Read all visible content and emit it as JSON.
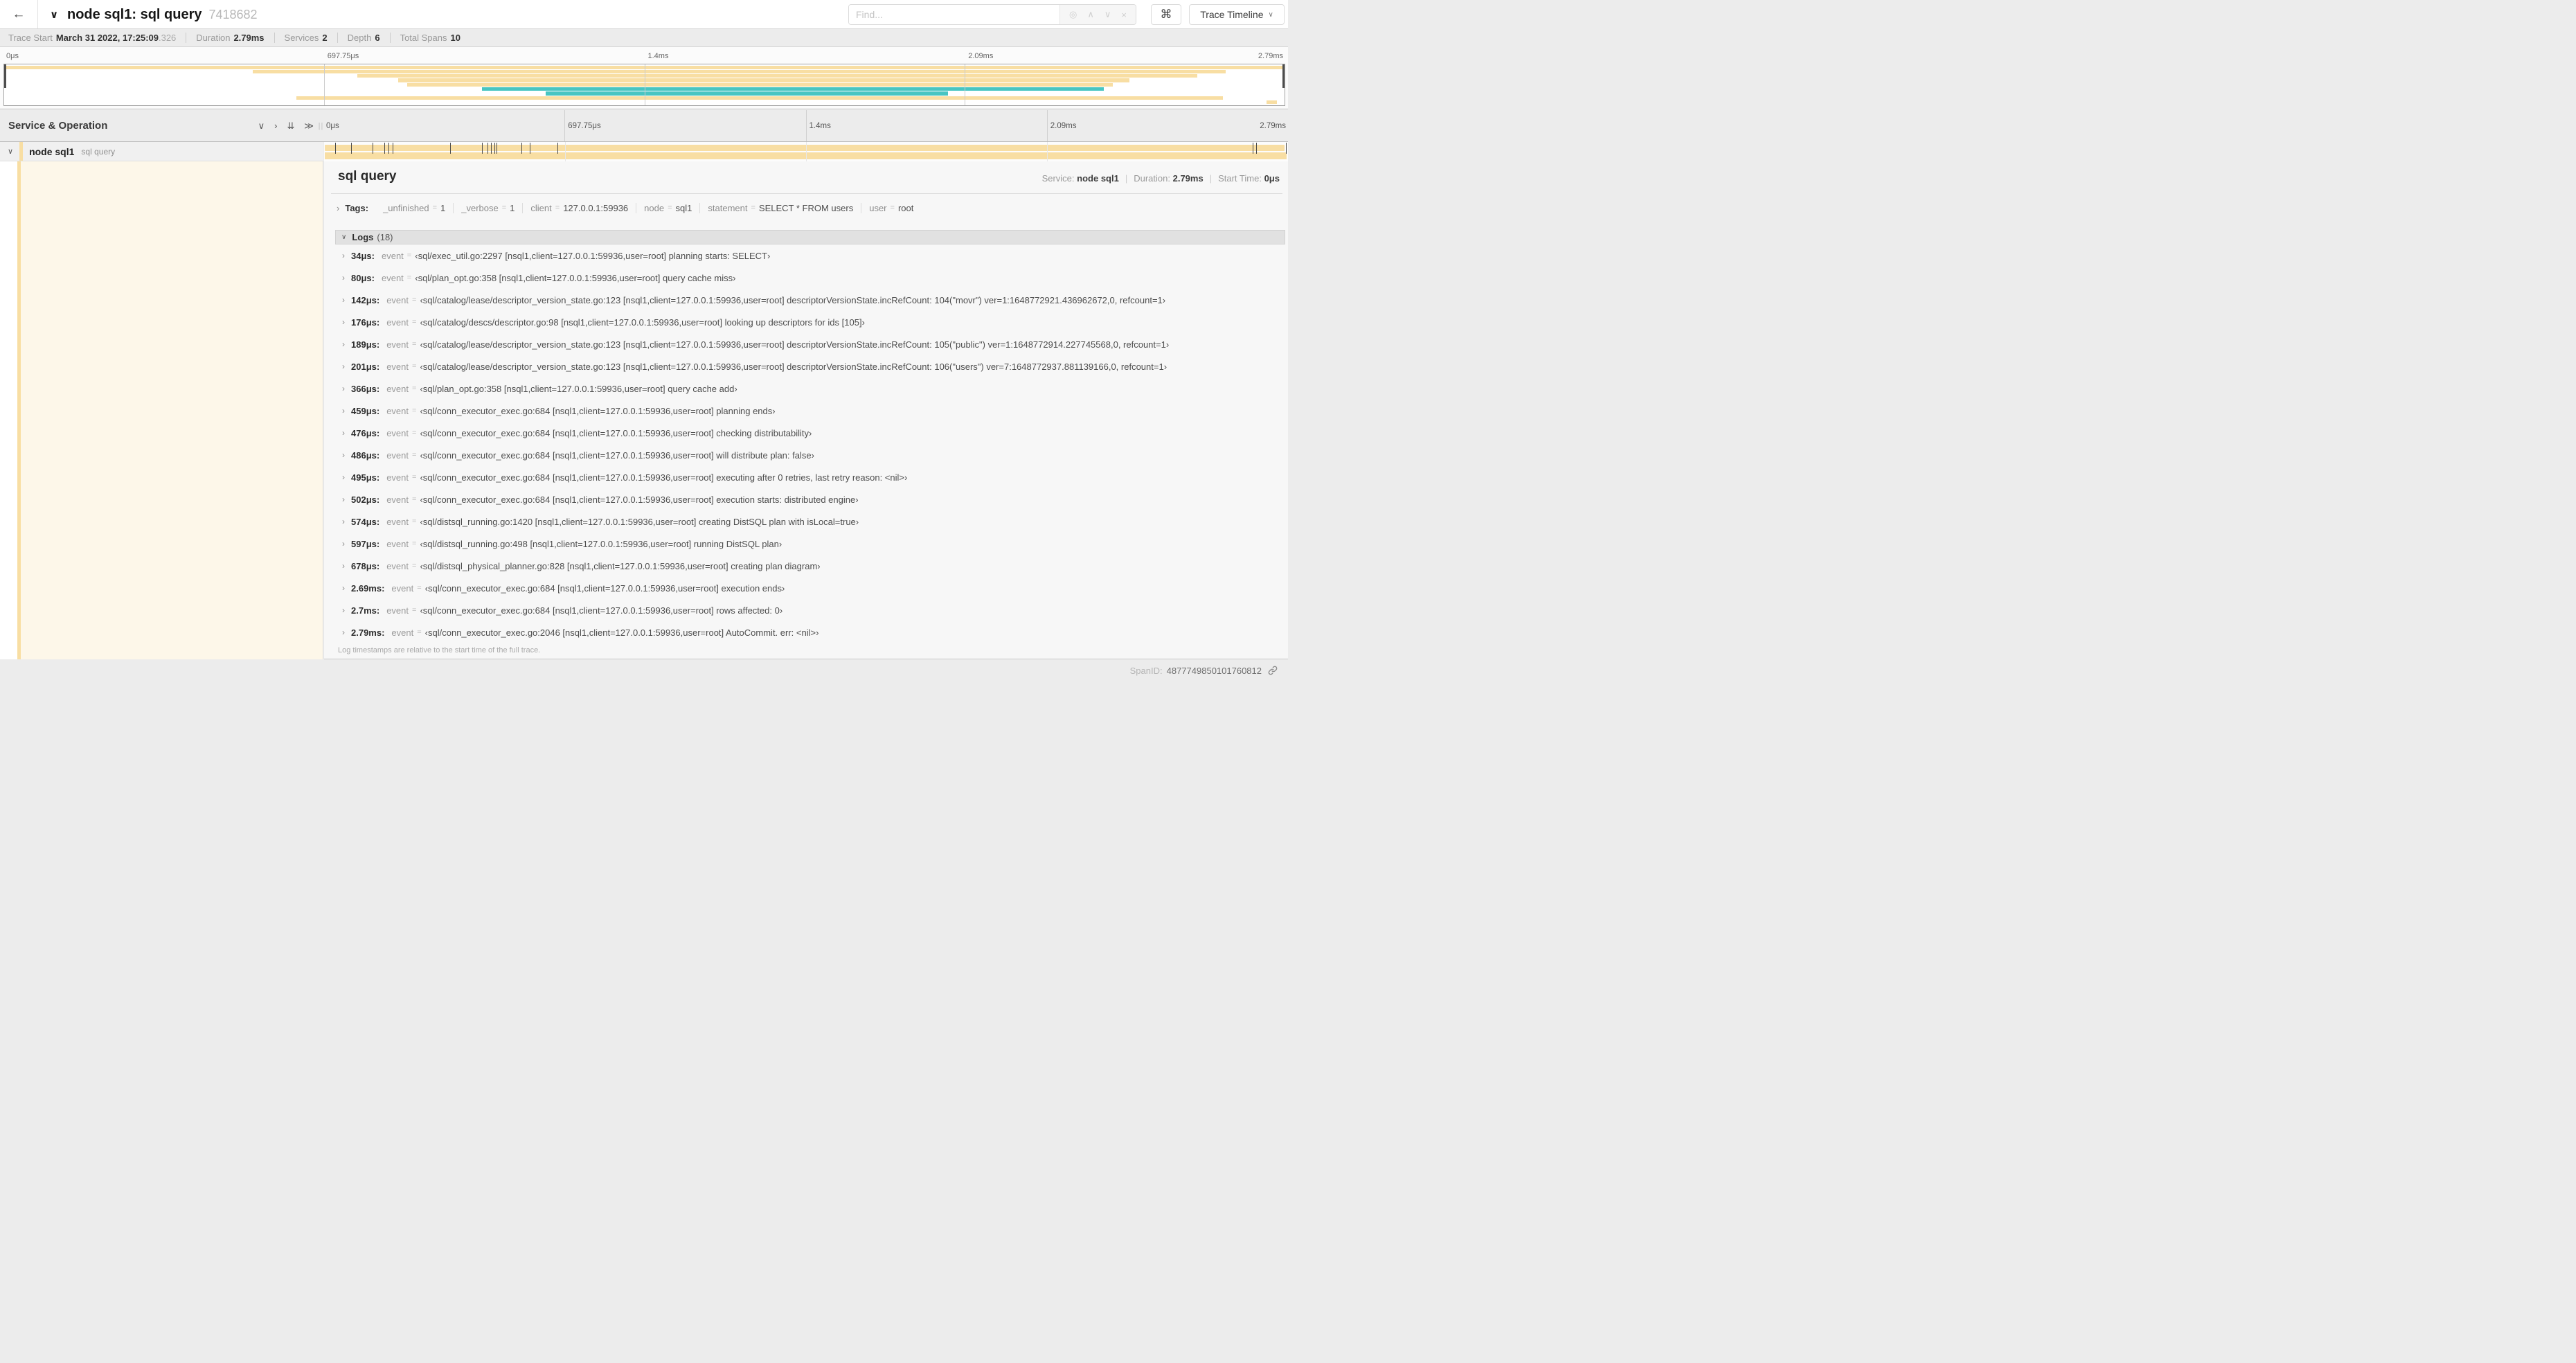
{
  "icons": {
    "back": "←",
    "collapse_trace": "∨",
    "find_locate": "◎",
    "find_prev": "∧",
    "find_next": "∨",
    "find_clear": "×",
    "shortcut": "⌘",
    "dropdown_caret": "∨",
    "collapse_one": "∨",
    "expand_one": "›",
    "collapse_all": "⇊",
    "expand_all": "≫",
    "resize_handle": "||",
    "row_chevron": "∨",
    "item_chevron": "›"
  },
  "header": {
    "title": "node sql1: sql query",
    "trace_id": "7418682",
    "find_placeholder": "Find...",
    "view_label": "Trace Timeline"
  },
  "meta": {
    "items": [
      {
        "label": "Trace Start",
        "value": "March 31 2022, 17:25:09",
        "suffix": ".326"
      },
      {
        "label": "Duration",
        "value": "2.79ms",
        "suffix": ""
      },
      {
        "label": "Services",
        "value": "2",
        "suffix": ""
      },
      {
        "label": "Depth",
        "value": "6",
        "suffix": ""
      },
      {
        "label": "Total Spans",
        "value": "10",
        "suffix": ""
      }
    ]
  },
  "colors": {
    "tan": "#f8dea3",
    "teal": "#48c5c2"
  },
  "timeline": {
    "left_header": "Service & Operation",
    "ticks": [
      "0μs",
      "697.75μs",
      "1.4ms",
      "2.09ms",
      "2.79ms"
    ],
    "total_us": 2790,
    "span": {
      "service": "node sql1",
      "operation": "sql query"
    },
    "markers_us": [
      34,
      80,
      142,
      176,
      189,
      201,
      366,
      459,
      476,
      486,
      495,
      502,
      574,
      597,
      678,
      2690,
      2700,
      2786
    ],
    "minimap_rows": [
      {
        "s": 0,
        "e": 100,
        "c": "tan"
      },
      {
        "s": 19.4,
        "e": 95.4,
        "c": "tan"
      },
      {
        "s": 27.6,
        "e": 93.2,
        "c": "tan"
      },
      {
        "s": 30.8,
        "e": 87.9,
        "c": "tan"
      },
      {
        "s": 31.5,
        "e": 86.6,
        "c": "tan"
      },
      {
        "s": 37.3,
        "e": 85.9,
        "c": "teal"
      },
      {
        "s": 42.3,
        "e": 73.7,
        "c": "teal"
      },
      {
        "s": 22.8,
        "e": 95.2,
        "c": "tan"
      },
      {
        "s": 98.6,
        "e": 99.4,
        "c": "tan"
      }
    ]
  },
  "detail": {
    "title": "sql query",
    "service_label": "Service:",
    "service": "node sql1",
    "duration_label": "Duration:",
    "duration": "2.79ms",
    "start_label": "Start Time:",
    "start": "0μs",
    "tags_label": "Tags:",
    "tags": [
      {
        "key": "_unfinished",
        "value": "1"
      },
      {
        "key": "_verbose",
        "value": "1"
      },
      {
        "key": "client",
        "value": "127.0.0.1:59936"
      },
      {
        "key": "node",
        "value": "sql1"
      },
      {
        "key": "statement",
        "value": "SELECT * FROM users"
      },
      {
        "key": "user",
        "value": "root"
      }
    ],
    "logs_label": "Logs",
    "logs_count": "(18)",
    "log_key": "event",
    "logs": [
      {
        "t": "34μs:",
        "msg": "‹sql/exec_util.go:2297 [nsql1,client=127.0.0.1:59936,user=root] planning starts: SELECT›"
      },
      {
        "t": "80μs:",
        "msg": "‹sql/plan_opt.go:358 [nsql1,client=127.0.0.1:59936,user=root] query cache miss›"
      },
      {
        "t": "142μs:",
        "msg": "‹sql/catalog/lease/descriptor_version_state.go:123 [nsql1,client=127.0.0.1:59936,user=root] descriptorVersionState.incRefCount: 104(\"movr\") ver=1:1648772921.436962672,0, refcount=1›"
      },
      {
        "t": "176μs:",
        "msg": "‹sql/catalog/descs/descriptor.go:98 [nsql1,client=127.0.0.1:59936,user=root] looking up descriptors for ids [105]›"
      },
      {
        "t": "189μs:",
        "msg": "‹sql/catalog/lease/descriptor_version_state.go:123 [nsql1,client=127.0.0.1:59936,user=root] descriptorVersionState.incRefCount: 105(\"public\") ver=1:1648772914.227745568,0, refcount=1›"
      },
      {
        "t": "201μs:",
        "msg": "‹sql/catalog/lease/descriptor_version_state.go:123 [nsql1,client=127.0.0.1:59936,user=root] descriptorVersionState.incRefCount: 106(\"users\") ver=7:1648772937.881139166,0, refcount=1›"
      },
      {
        "t": "366μs:",
        "msg": "‹sql/plan_opt.go:358 [nsql1,client=127.0.0.1:59936,user=root] query cache add›"
      },
      {
        "t": "459μs:",
        "msg": "‹sql/conn_executor_exec.go:684 [nsql1,client=127.0.0.1:59936,user=root] planning ends›"
      },
      {
        "t": "476μs:",
        "msg": "‹sql/conn_executor_exec.go:684 [nsql1,client=127.0.0.1:59936,user=root] checking distributability›"
      },
      {
        "t": "486μs:",
        "msg": "‹sql/conn_executor_exec.go:684 [nsql1,client=127.0.0.1:59936,user=root] will distribute plan: false›"
      },
      {
        "t": "495μs:",
        "msg": "‹sql/conn_executor_exec.go:684 [nsql1,client=127.0.0.1:59936,user=root] executing after 0 retries, last retry reason: <nil>›"
      },
      {
        "t": "502μs:",
        "msg": "‹sql/conn_executor_exec.go:684 [nsql1,client=127.0.0.1:59936,user=root] execution starts: distributed engine›"
      },
      {
        "t": "574μs:",
        "msg": "‹sql/distsql_running.go:1420 [nsql1,client=127.0.0.1:59936,user=root] creating DistSQL plan with isLocal=true›"
      },
      {
        "t": "597μs:",
        "msg": "‹sql/distsql_running.go:498 [nsql1,client=127.0.0.1:59936,user=root] running DistSQL plan›"
      },
      {
        "t": "678μs:",
        "msg": "‹sql/distsql_physical_planner.go:828 [nsql1,client=127.0.0.1:59936,user=root] creating plan diagram›"
      },
      {
        "t": "2.69ms:",
        "msg": "‹sql/conn_executor_exec.go:684 [nsql1,client=127.0.0.1:59936,user=root] execution ends›"
      },
      {
        "t": "2.7ms:",
        "msg": "‹sql/conn_executor_exec.go:684 [nsql1,client=127.0.0.1:59936,user=root] rows affected: 0›"
      },
      {
        "t": "2.79ms:",
        "msg": "‹sql/conn_executor_exec.go:2046 [nsql1,client=127.0.0.1:59936,user=root] AutoCommit. err: <nil>›"
      }
    ],
    "footnote": "Log timestamps are relative to the start time of the full trace.",
    "span_id_label": "SpanID:",
    "span_id": "4877749850101760812"
  }
}
